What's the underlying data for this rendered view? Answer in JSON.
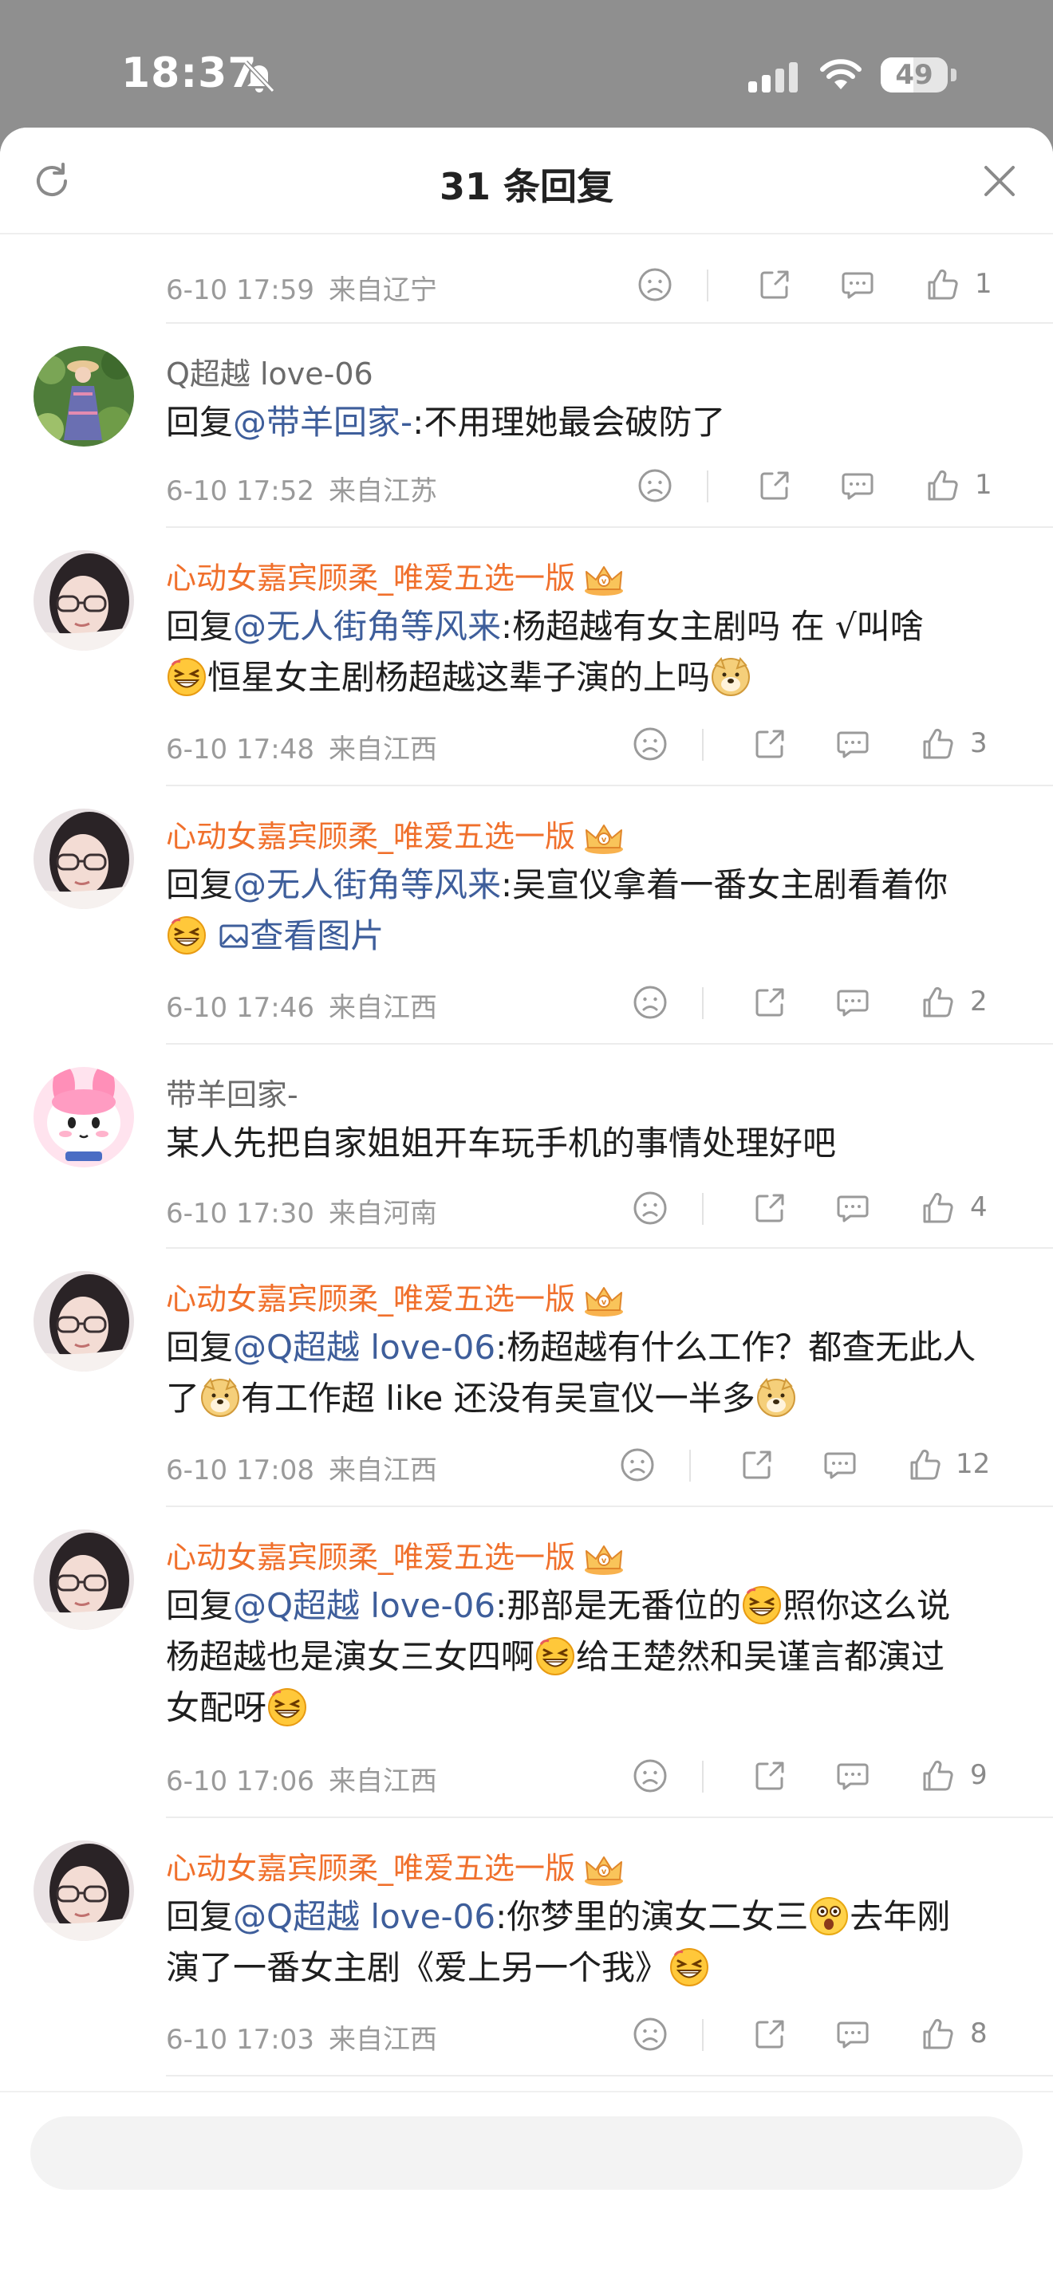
{
  "status_bar": {
    "time": "18:37",
    "battery": "49",
    "battery_level": 0.49
  },
  "header": {
    "title": "31 条回复"
  },
  "icons": {
    "refresh": "refresh-icon",
    "close": "close-icon",
    "bell_off": "bell-slash-icon",
    "dislike": "frown-icon",
    "share": "share-icon",
    "comment": "comment-bubble-icon",
    "like": "thumbs-up-icon",
    "emoji_grin": "grinning-emoji",
    "emoji_doge": "doge-emoji",
    "emoji_shock": "shocked-emoji",
    "crown": "crown-badge-icon"
  },
  "colors": {
    "vip_name": "#f0702c",
    "mention": "#3e5e9b",
    "meta": "#9a9a9a"
  },
  "comments": [
    {
      "meta_time": "6-10 17:59",
      "meta_loc": "来自辽宁",
      "likes": "1",
      "partial_top": true
    },
    {
      "name": "Q超越 love-06",
      "vip": false,
      "reply_prefix": "回复",
      "mention": "@带羊回家-",
      "text": ":不用理她最会破防了",
      "meta_time": "6-10 17:52",
      "meta_loc": "来自江苏",
      "likes": "1"
    },
    {
      "name": "心动女嘉宾顾柔_唯爱五选一版",
      "vip": true,
      "reply_prefix": "回复",
      "mention": "@无人街角等风来",
      "text1": ":杨超越有女主剧吗 在 √叫啥",
      "text2": "恒星女主剧杨超越这辈子演的上吗",
      "meta_time": "6-10 17:48",
      "meta_loc": "来自江西",
      "likes": "3"
    },
    {
      "name": "心动女嘉宾顾柔_唯爱五选一版",
      "vip": true,
      "reply_prefix": "回复",
      "mention": "@无人街角等风来",
      "text": ":吴宣仪拿着一番女主剧看着你",
      "view_image": "查看图片",
      "meta_time": "6-10 17:46",
      "meta_loc": "来自江西",
      "likes": "2"
    },
    {
      "name": "带羊回家-",
      "vip": false,
      "text": "某人先把自家姐姐开车玩手机的事情处理好吧",
      "meta_time": "6-10 17:30",
      "meta_loc": "来自河南",
      "likes": "4"
    },
    {
      "name": "心动女嘉宾顾柔_唯爱五选一版",
      "vip": true,
      "reply_prefix": "回复",
      "mention": "@Q超越 love-06",
      "text1": ":杨超越有什么工作？都查无此人",
      "text2": "了",
      "text3": "有工作超 like 还没有吴宣仪一半多",
      "meta_time": "6-10 17:08",
      "meta_loc": "来自江西",
      "likes": "12"
    },
    {
      "name": "心动女嘉宾顾柔_唯爱五选一版",
      "vip": true,
      "reply_prefix": "回复",
      "mention": "@Q超越 love-06",
      "text1": ":那部是无番位的",
      "text2": "照你这么说",
      "text3": "杨超越也是演女三女四啊",
      "text4": "给王楚然和吴谨言都演过",
      "text5": "女配呀",
      "meta_time": "6-10 17:06",
      "meta_loc": "来自江西",
      "likes": "9"
    },
    {
      "name": "心动女嘉宾顾柔_唯爱五选一版",
      "vip": true,
      "reply_prefix": "回复",
      "mention": "@Q超越 love-06",
      "text1": ":你梦里的演女二女三",
      "text2": "去年刚",
      "text3": "演了一番女主剧《爱上另一个我》",
      "meta_time": "6-10 17:03",
      "meta_loc": "来自江西",
      "likes": "8"
    }
  ],
  "input": {
    "placeholder": ""
  }
}
